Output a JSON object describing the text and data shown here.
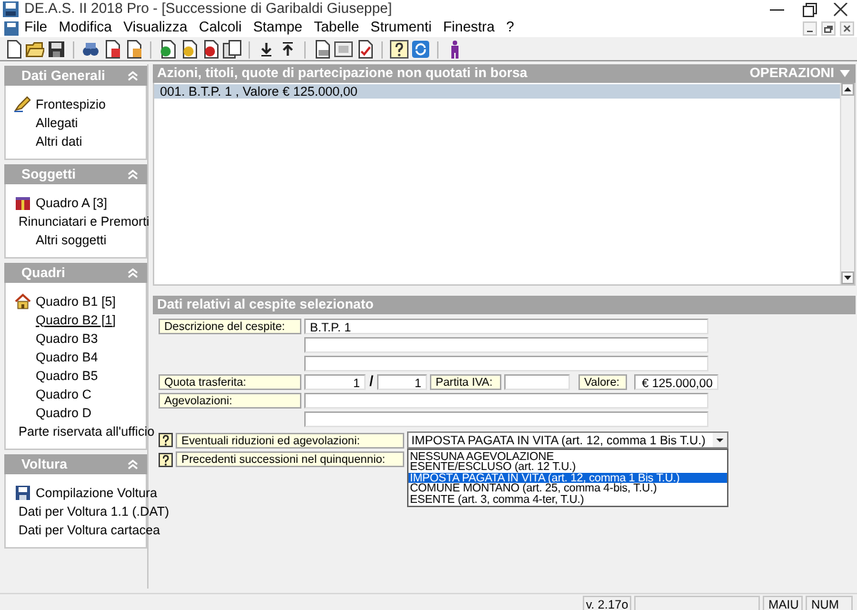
{
  "window": {
    "title": "DE.A.S. II 2018 Pro - [Successione di Garibaldi Giuseppe]"
  },
  "menu": [
    {
      "label": "File"
    },
    {
      "label": "Modifica"
    },
    {
      "label": "Visualizza"
    },
    {
      "label": "Calcoli"
    },
    {
      "label": "Stampe"
    },
    {
      "label": "Tabelle"
    },
    {
      "label": "Strumenti"
    },
    {
      "label": "Finestra"
    },
    {
      "label": "?"
    }
  ],
  "sidebar": {
    "groups": [
      {
        "title": "Dati Generali",
        "items": [
          {
            "label": "Frontespizio",
            "selected": false
          },
          {
            "label": "Allegati",
            "selected": false
          },
          {
            "label": "Altri dati",
            "selected": false
          }
        ]
      },
      {
        "title": "Soggetti",
        "items": [
          {
            "label": "Quadro A [3]",
            "selected": false
          },
          {
            "label": "Rinunciatari e Premorti",
            "selected": false
          },
          {
            "label": "Altri soggetti",
            "selected": false
          }
        ]
      },
      {
        "title": "Quadri",
        "items": [
          {
            "label": "Quadro B1 [5]",
            "selected": false
          },
          {
            "label": "Quadro B2 [1]",
            "selected": true
          },
          {
            "label": "Quadro B3",
            "selected": false
          },
          {
            "label": "Quadro B4",
            "selected": false
          },
          {
            "label": "Quadro B5",
            "selected": false
          },
          {
            "label": "Quadro C",
            "selected": false
          },
          {
            "label": "Quadro D",
            "selected": false
          },
          {
            "label": "Parte riservata all'ufficio",
            "selected": false
          }
        ]
      },
      {
        "title": "Voltura",
        "items": [
          {
            "label": "Compilazione Voltura",
            "selected": false
          },
          {
            "label": "Dati per Voltura 1.1 (.DAT)",
            "selected": false
          },
          {
            "label": "Dati per Voltura cartacea",
            "selected": false
          }
        ]
      }
    ]
  },
  "assets": {
    "title": "Azioni, titoli, quote di partecipazione non quotati in borsa",
    "operations": "OPERAZIONI",
    "rows": [
      {
        "label": "001. B.T.P. 1 , Valore € 125.000,00",
        "selected": true
      }
    ]
  },
  "detail": {
    "title": "Dati relativi al cespite selezionato",
    "description": {
      "label": "Descrizione del cespite:",
      "value": "B.T.P. 1"
    },
    "quota": {
      "label": "Quota trasferita:",
      "numerator": "1",
      "separator": "/",
      "denominator": "1"
    },
    "partita_iva": {
      "label": "Partita IVA:"
    },
    "valore": {
      "label": "Valore:",
      "value": "€ 125.000,00"
    },
    "agevolazioni": {
      "label": "Agevolazioni:"
    },
    "riduzioni": {
      "label": "Eventuali riduzioni ed agevolazioni:",
      "value": "IMPOSTA PAGATA IN VITA (art. 12, comma 1 Bis T.U.)",
      "expanded": true,
      "options": [
        {
          "label": "NESSUNA AGEVOLAZIONE",
          "selected": false
        },
        {
          "label": "ESENTE/ESCLUSO (art. 12 T.U.)",
          "selected": false
        },
        {
          "label": "IMPOSTA PAGATA IN VITA (art. 12, comma 1 Bis T.U.)",
          "selected": true
        },
        {
          "label": "COMUNE MONTANO (art. 25, comma 4-bis, T.U.)",
          "selected": false
        },
        {
          "label": "ESENTE (art. 3, comma 4-ter, T.U.)",
          "selected": false
        }
      ]
    },
    "precedenti": {
      "label": "Precedenti successioni nel quinquennio:"
    }
  },
  "status_bar": {
    "version": "v. 2.17o",
    "caps": "MAIU",
    "num": "NUM"
  }
}
